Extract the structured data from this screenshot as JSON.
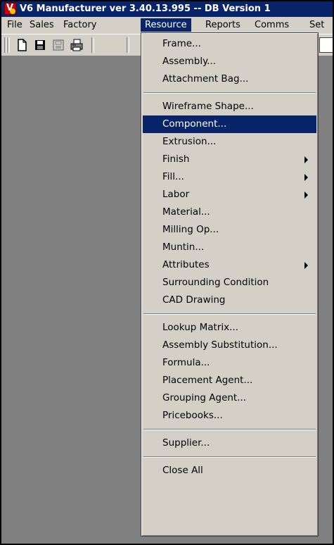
{
  "window": {
    "title": "V6 Manufacturer ver 3.40.13.995 -- DB Version 1"
  },
  "menubar": {
    "items": [
      {
        "label": "File"
      },
      {
        "label": "Sales"
      },
      {
        "label": "Factory"
      },
      {
        "label": "Resource",
        "active": true
      },
      {
        "label": "Reports"
      },
      {
        "label": "Comms"
      },
      {
        "label": "Set"
      }
    ]
  },
  "toolbar": {
    "buttons": [
      {
        "icon": "new-document-icon"
      },
      {
        "icon": "save-disk-icon"
      },
      {
        "icon": "disabled-save-icon"
      },
      {
        "icon": "print-icon"
      }
    ]
  },
  "resource_menu": {
    "groups": [
      [
        {
          "label": "Frame..."
        },
        {
          "label": "Assembly..."
        },
        {
          "label": "Attachment Bag..."
        }
      ],
      [
        {
          "label": "Wireframe Shape..."
        },
        {
          "label": "Component...",
          "highlighted": true
        },
        {
          "label": "Extrusion..."
        },
        {
          "label": "Finish",
          "submenu": true
        },
        {
          "label": "Fill...",
          "submenu": true
        },
        {
          "label": "Labor",
          "submenu": true
        },
        {
          "label": "Material..."
        },
        {
          "label": "Milling Op..."
        },
        {
          "label": "Muntin..."
        },
        {
          "label": "Attributes",
          "submenu": true
        },
        {
          "label": "Surrounding Condition"
        },
        {
          "label": "CAD Drawing"
        }
      ],
      [
        {
          "label": "Lookup Matrix..."
        },
        {
          "label": "Assembly Substitution..."
        },
        {
          "label": "Formula..."
        },
        {
          "label": "Placement Agent..."
        },
        {
          "label": "Grouping Agent..."
        },
        {
          "label": "Pricebooks..."
        }
      ],
      [
        {
          "label": "Supplier..."
        }
      ],
      [
        {
          "label": "Close All"
        }
      ]
    ]
  },
  "colors": {
    "title_bar": "#0a246a",
    "menu_face": "#d4d0c8",
    "highlight": "#0a246a",
    "workspace": "#808080"
  }
}
